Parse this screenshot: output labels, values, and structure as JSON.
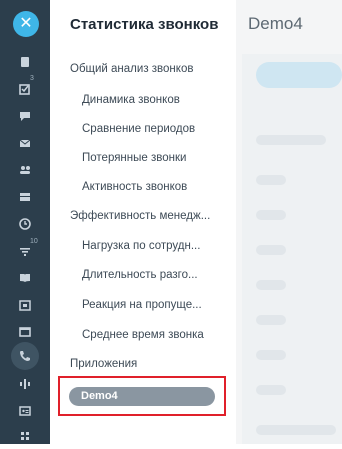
{
  "rail": {
    "close_icon": "close-icon",
    "items": [
      {
        "icon": "document-icon"
      },
      {
        "icon": "checkbox-icon",
        "badge": "3"
      },
      {
        "icon": "chat-icon"
      },
      {
        "icon": "mail-icon"
      },
      {
        "icon": "users-icon"
      },
      {
        "icon": "storage-icon"
      },
      {
        "icon": "clock-icon"
      },
      {
        "icon": "filter-icon",
        "badge": "10"
      },
      {
        "icon": "book-icon"
      },
      {
        "icon": "calendar-icon"
      },
      {
        "icon": "window-icon"
      },
      {
        "icon": "phone-icon",
        "active": true
      },
      {
        "icon": "network-icon"
      },
      {
        "icon": "id-card-icon"
      },
      {
        "icon": "grid-icon"
      }
    ]
  },
  "sidebar": {
    "title": "Статистика звонков",
    "items": [
      {
        "label": "Общий анализ звонков",
        "level": "top"
      },
      {
        "label": "Динамика звонков",
        "level": "sub"
      },
      {
        "label": "Сравнение периодов",
        "level": "sub"
      },
      {
        "label": "Потерянные звонки",
        "level": "sub"
      },
      {
        "label": "Активность звонков",
        "level": "sub"
      },
      {
        "label": "Эффективность менедж...",
        "level": "top"
      },
      {
        "label": "Нагрузка по сотрудн...",
        "level": "sub"
      },
      {
        "label": "Длительность разго...",
        "level": "sub"
      },
      {
        "label": "Реакция на пропуще...",
        "level": "sub"
      },
      {
        "label": "Среднее время звонка",
        "level": "sub"
      },
      {
        "label": "Приложения",
        "level": "top"
      }
    ],
    "app_item": "Demo4"
  },
  "main": {
    "title": "Demo4"
  },
  "colors": {
    "rail_bg": "#2c3e4c",
    "accent": "#3fb6e8",
    "highlight": "#e0202a",
    "pill": "#8a96a1"
  }
}
